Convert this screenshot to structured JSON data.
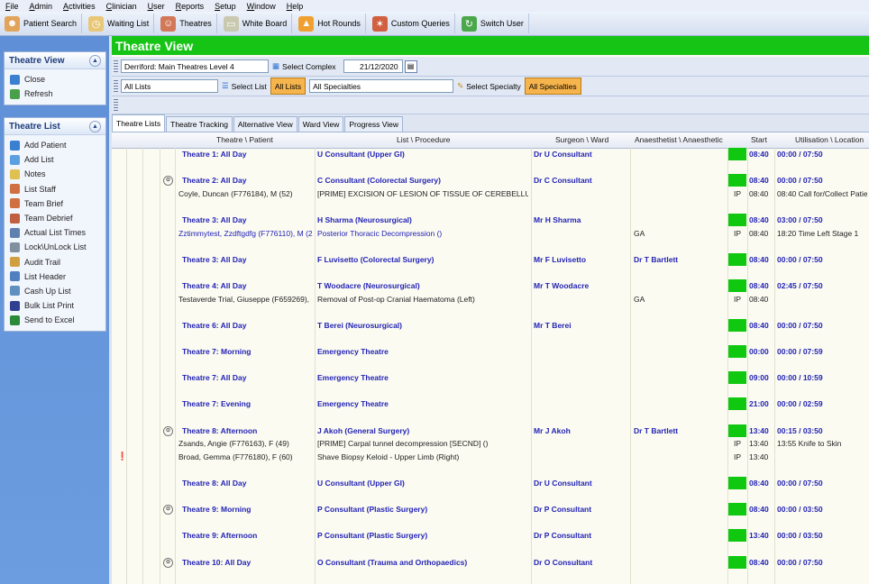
{
  "menu": [
    "File",
    "Admin",
    "Activities",
    "Clinician",
    "User",
    "Reports",
    "Setup",
    "Window",
    "Help"
  ],
  "toolbar": [
    {
      "label": "Patient Search",
      "icon": "person-search-icon"
    },
    {
      "label": "Waiting List",
      "icon": "clock-icon"
    },
    {
      "label": "Theatres",
      "icon": "surgeon-icon"
    },
    {
      "label": "White Board",
      "icon": "whiteboard-icon"
    },
    {
      "label": "Hot Rounds",
      "icon": "flame-icon"
    },
    {
      "label": "Custom Queries",
      "icon": "puzzle-icon"
    },
    {
      "label": "Switch User",
      "icon": "switch-user-icon"
    }
  ],
  "sidebar": {
    "theatre_view": {
      "title": "Theatre View",
      "items": [
        {
          "label": "Close",
          "icon": "close-circle-icon"
        },
        {
          "label": "Refresh",
          "icon": "refresh-icon"
        }
      ]
    },
    "theatre_list": {
      "title": "Theatre List",
      "items": [
        {
          "label": "Add Patient",
          "icon": "add-patient-icon"
        },
        {
          "label": "Add List",
          "icon": "add-list-icon"
        },
        {
          "label": "Notes",
          "icon": "notes-icon"
        },
        {
          "label": "List Staff",
          "icon": "staff-icon"
        },
        {
          "label": "Team Brief",
          "icon": "team-brief-icon"
        },
        {
          "label": "Team Debrief",
          "icon": "team-debrief-icon"
        },
        {
          "label": "Actual List Times",
          "icon": "clock-icon"
        },
        {
          "label": "Lock\\UnLock List",
          "icon": "lock-icon"
        },
        {
          "label": "Audit Trail",
          "icon": "audit-icon"
        },
        {
          "label": "List Header",
          "icon": "list-header-icon"
        },
        {
          "label": "Cash Up List",
          "icon": "cash-icon"
        },
        {
          "label": "Bulk List Print",
          "icon": "print-icon"
        },
        {
          "label": "Send to Excel",
          "icon": "excel-icon"
        }
      ]
    }
  },
  "main": {
    "title": "Theatre View",
    "complex": {
      "value": "Derriford: Main Theatres Level 4",
      "button": "Select Complex",
      "date": "21/12/2020"
    },
    "lists": {
      "value": "All Lists",
      "button": "Select List",
      "toggle": "All Lists",
      "specialty_value": "All Specialties",
      "specialty_button": "Select Specialty",
      "specialty_toggle": "All Specialties"
    },
    "tabs": [
      "Theatre Lists",
      "Theatre Tracking",
      "Alternative View",
      "Ward View",
      "Progress View"
    ],
    "columns": {
      "theatre": "Theatre \\ Patient",
      "list": "List \\ Procedure",
      "surgeon": "Surgeon \\ Ward",
      "anaes": "Anaesthetist \\ Anaesthetic",
      "start": "Start",
      "util": "Utilisation \\ Location"
    }
  },
  "rows": [
    {
      "kind": "theatre",
      "theatre": "Theatre 1: All Day",
      "list": "U Consultant (Upper GI)",
      "surgeon": "Dr U Consultant",
      "anaes": "",
      "start": "08:40",
      "util": "00:00 / 07:50"
    },
    {
      "kind": "gap"
    },
    {
      "kind": "theatre",
      "circle": true,
      "theatre": "Theatre 2: All Day",
      "list": "C Consultant (Colorectal Surgery)",
      "surgeon": "Dr C Consultant",
      "anaes": "",
      "start": "08:40",
      "util": "00:00 / 07:50"
    },
    {
      "kind": "patient",
      "theatre": "Coyle, Duncan (F776184), M (52)",
      "list": "[PRIME]  EXCISION OF LESION OF TISSUE OF CEREBELLU",
      "surgeon": "",
      "anaes": "",
      "ip": "IP",
      "start": "08:40",
      "util": "08:40  Call for/Collect Patie"
    },
    {
      "kind": "gap"
    },
    {
      "kind": "theatre",
      "theatre": "Theatre 3: All Day",
      "list": "H Sharma (Neurosurgical)",
      "surgeon": "Mr H Sharma",
      "anaes": "",
      "start": "08:40",
      "util": "03:00 / 07:50"
    },
    {
      "kind": "patient",
      "blue": true,
      "theatre": "Zztimmytest, Zzdftgdfg (F776110), M (2",
      "list": "Posterior Thoracic Decompression ()",
      "surgeon": "",
      "anaes": "GA",
      "ip": "IP",
      "start": "08:40",
      "util": "18:20  Time Left Stage 1"
    },
    {
      "kind": "gap"
    },
    {
      "kind": "theatre",
      "theatre": "Theatre 3: All Day",
      "list": "F Luvisetto (Colorectal Surgery)",
      "surgeon": "Mr F Luvisetto",
      "anaes": "Dr T Bartlett",
      "start": "08:40",
      "util": "00:00 / 07:50"
    },
    {
      "kind": "gap"
    },
    {
      "kind": "theatre",
      "theatre": "Theatre 4: All Day",
      "list": "T Woodacre (Neurosurgical)",
      "surgeon": "Mr T Woodacre",
      "anaes": "",
      "start": "08:40",
      "util": "02:45 / 07:50"
    },
    {
      "kind": "patient",
      "theatre": "Testaverde Trial, Giuseppe (F659269),",
      "list": "Removal of Post-op Cranial Haematoma (Left)",
      "surgeon": "",
      "anaes": "GA",
      "ip": "IP",
      "start": "08:40",
      "util": ""
    },
    {
      "kind": "gap"
    },
    {
      "kind": "theatre",
      "theatre": "Theatre 6: All Day",
      "list": "T Berei (Neurosurgical)",
      "surgeon": "Mr T Berei",
      "anaes": "",
      "start": "08:40",
      "util": "00:00 / 07:50"
    },
    {
      "kind": "gap"
    },
    {
      "kind": "theatre",
      "theatre": "Theatre 7: Morning",
      "list": "Emergency Theatre",
      "surgeon": "",
      "anaes": "",
      "start": "00:00",
      "util": "00:00 / 07:59"
    },
    {
      "kind": "gap"
    },
    {
      "kind": "theatre",
      "theatre": "Theatre 7: All Day",
      "list": "Emergency Theatre",
      "surgeon": "",
      "anaes": "",
      "start": "09:00",
      "util": "00:00 / 10:59"
    },
    {
      "kind": "gap"
    },
    {
      "kind": "theatre",
      "theatre": "Theatre 7: Evening",
      "list": "Emergency Theatre",
      "surgeon": "",
      "anaes": "",
      "start": "21:00",
      "util": "00:00 / 02:59"
    },
    {
      "kind": "gap"
    },
    {
      "kind": "theatre",
      "circle": true,
      "theatre": "Theatre 8: Afternoon",
      "list": "J Akoh (General Surgery)",
      "surgeon": "Mr J Akoh",
      "anaes": "Dr T Bartlett",
      "start": "13:40",
      "util": "00:15 / 03:50"
    },
    {
      "kind": "patient",
      "theatre": "Zsands, Angie (F776163), F (49)",
      "list": "[PRIME]  Carpal tunnel decompression   [SECND] ()",
      "surgeon": "",
      "anaes": "",
      "ip": "IP",
      "start": "13:40",
      "util": "13:55  Knife to Skin"
    },
    {
      "kind": "patient",
      "flag": true,
      "theatre": "Broad, Gemma (F776180), F (60)",
      "list": "Shave Biopsy Keloid - Upper Limb (Right)",
      "surgeon": "",
      "anaes": "",
      "ip": "IP",
      "start": "13:40",
      "util": ""
    },
    {
      "kind": "gap"
    },
    {
      "kind": "theatre",
      "theatre": "Theatre 8: All Day",
      "list": "U Consultant (Upper GI)",
      "surgeon": "Dr U Consultant",
      "anaes": "",
      "start": "08:40",
      "util": "00:00 / 07:50"
    },
    {
      "kind": "gap"
    },
    {
      "kind": "theatre",
      "circle": true,
      "theatre": "Theatre 9: Morning",
      "list": "P Consultant (Plastic Surgery)",
      "surgeon": "Dr P Consultant",
      "anaes": "",
      "start": "08:40",
      "util": "00:00 / 03:50"
    },
    {
      "kind": "gap"
    },
    {
      "kind": "theatre",
      "theatre": "Theatre 9: Afternoon",
      "list": "P Consultant (Plastic Surgery)",
      "surgeon": "Dr P Consultant",
      "anaes": "",
      "start": "13:40",
      "util": "00:00 / 03:50"
    },
    {
      "kind": "gap"
    },
    {
      "kind": "theatre",
      "circle": true,
      "theatre": "Theatre 10: All Day",
      "list": "O Consultant (Trauma and Orthopaedics)",
      "surgeon": "Dr O Consultant",
      "anaes": "",
      "start": "08:40",
      "util": "00:00 / 07:50"
    }
  ]
}
